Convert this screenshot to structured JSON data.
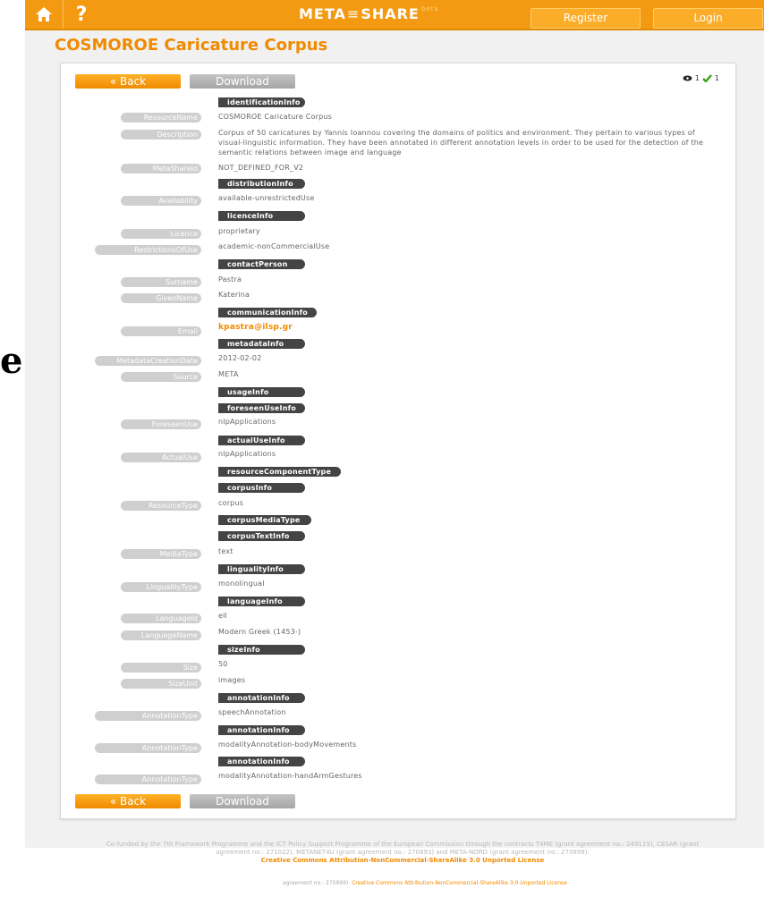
{
  "nav": {
    "logo_text_left": "META",
    "logo_mid": "≡",
    "logo_text_right": "SHARE",
    "logo_beta": "beta",
    "help": "?",
    "register": "Register",
    "login": "Login"
  },
  "side_mark": "e",
  "page_title": "COSMOROE Caricature Corpus",
  "buttons": {
    "back": "« Back",
    "download": "Download"
  },
  "stats": {
    "views": "1",
    "downloads": "1"
  },
  "sections": {
    "identificationInfo": "identificationInfo",
    "distributionInfo": "distributionInfo",
    "licenceInfo": "licenceInfo",
    "contactPerson": "contactPerson",
    "communicationInfo": "communicationInfo",
    "metadataInfo": "metadataInfo",
    "usageInfo": "usageInfo",
    "foreseenUseInfo": "foreseenUseInfo",
    "actualUseInfo": "actualUseInfo",
    "resourceComponentType": "resourceComponentType",
    "corpusInfo": "corpusInfo",
    "corpusMediaType": "corpusMediaType",
    "corpusTextInfo": "corpusTextInfo",
    "linguality": "lingualityInfo",
    "languageInfo": "languageInfo",
    "sizeInfo": "sizeInfo",
    "annotationInfo": "annotationInfo"
  },
  "fields": {
    "resourceName": {
      "label": "ResourceName",
      "value": "COSMOROE Caricature Corpus"
    },
    "description": {
      "label": "Description",
      "value": "Corpus of 50 caricatures by Yannis Ioannou covering the domains of politics and environment. They pertain to various types of visual-linguistic information. They have been annotated in different annotation levels in order to be used for the detection of the semantic relations between image and language"
    },
    "metaShareId": {
      "label": "MetaShareId",
      "value": "NOT_DEFINED_FOR_V2"
    },
    "availability": {
      "label": "Availability",
      "value": "available-unrestrictedUse"
    },
    "licence": {
      "label": "Licence",
      "value": "proprietary"
    },
    "restrictionsOfUse": {
      "label": "RestrictionsOfUse",
      "value": "academic-nonCommercialUse"
    },
    "surname": {
      "label": "Surname",
      "value": "Pastra"
    },
    "givenName": {
      "label": "GivenName",
      "value": "Katerina"
    },
    "email": {
      "label": "Email",
      "value": "kpastra@ilsp.gr"
    },
    "metadataCreationDate": {
      "label": "MetadataCreationDate",
      "value": "2012-02-02"
    },
    "source": {
      "label": "Source",
      "value": "META"
    },
    "foreseenUse": {
      "label": "ForeseenUse",
      "value": "nlpApplications"
    },
    "actualUse": {
      "label": "ActualUse",
      "value": "nlpApplications"
    },
    "resourceType": {
      "label": "ResourceType",
      "value": "corpus"
    },
    "mediaType": {
      "label": "MediaType",
      "value": "text"
    },
    "lingualityType": {
      "label": "LingualityType",
      "value": "monolingual"
    },
    "languageId": {
      "label": "LanguageId",
      "value": "ell"
    },
    "languageName": {
      "label": "LanguageName",
      "value": "Modern Greek (1453-)"
    },
    "size": {
      "label": "Size",
      "value": "50"
    },
    "sizeUnit": {
      "label": "SizeUnit",
      "value": "images"
    },
    "annotationType1": {
      "label": "AnnotationType",
      "value": "speechAnnotation"
    },
    "annotationType2": {
      "label": "AnnotationType",
      "value": "modalityAnnotation-bodyMovements"
    },
    "annotationType3": {
      "label": "AnnotationType",
      "value": "modalityAnnotation-handArmGestures"
    }
  },
  "footer": {
    "text": "Co-funded by the 7th Framework Programme and the ICT Policy Support Programme of the European Commission through the contracts T4ME (grant agreement no.: 249119), CESAR (grant agreement no.: 271022), METANET4U (grant agreement no.: 270893) and META-NORD (grant agreement no.: 270899).",
    "license": "Creative Commons Attribution-NonCommercial-ShareAlike 3.0 Unported License",
    "repeat_prefix": "agreement no.: 270899).",
    "repeat_license": "Creative Commons Attribution-NonCommercial-ShareAlike 3.0 Unported License"
  },
  "colors": {
    "accent": "#f39a12",
    "section_bg": "#444444",
    "label_bg": "#cfcfcf",
    "link": "#f08a00"
  }
}
